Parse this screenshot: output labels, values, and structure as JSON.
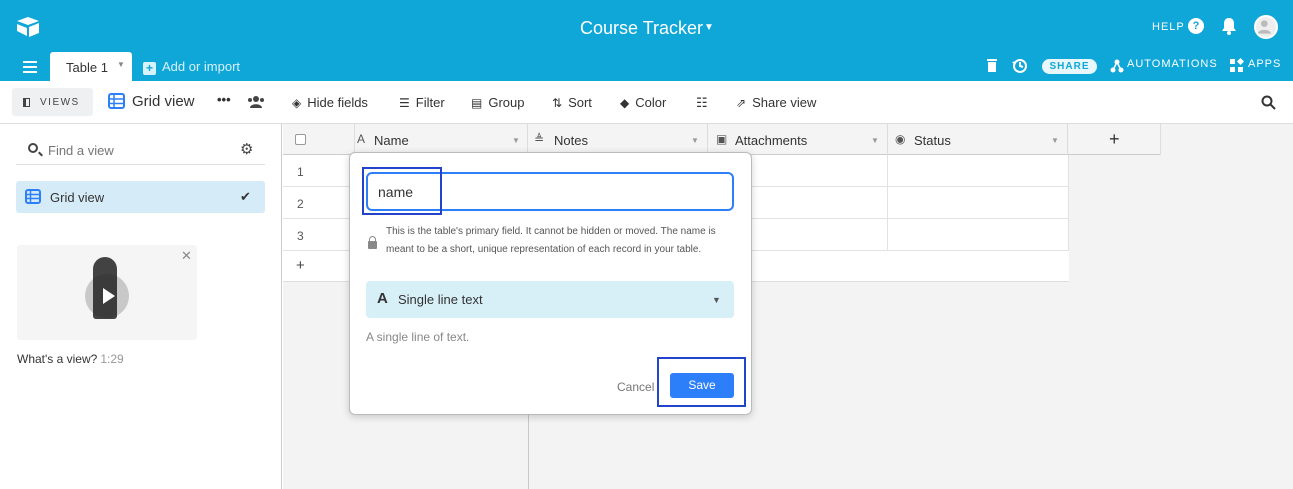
{
  "topbar": {
    "title": "Course Tracker",
    "help": "HELP",
    "help_icon": "?",
    "share": "SHARE",
    "automations": "AUTOMATIONS",
    "apps": "APPS",
    "table_tab": "Table 1",
    "add_or_import": "Add or import",
    "bg_color": "#0fa6d8"
  },
  "viewbar": {
    "views": "VIEWS",
    "view_name": "Grid view",
    "more": "•••",
    "hide_fields": "Hide fields",
    "filter": "Filter",
    "group": "Group",
    "sort": "Sort",
    "color": "Color",
    "share_view": "Share view"
  },
  "sidebar": {
    "find_placeholder": "Find a view",
    "grid_view": "Grid view",
    "check": "✔",
    "whats_view": "What's a view?",
    "duration": "1:29",
    "close": "✕"
  },
  "grid": {
    "columns": [
      {
        "name": "Name",
        "icon": "text-icon"
      },
      {
        "name": "Notes",
        "icon": "long-text-icon"
      },
      {
        "name": "Attachments",
        "icon": "attachment-icon"
      },
      {
        "name": "Status",
        "icon": "status-icon"
      }
    ],
    "add_column": "+",
    "rows": [
      "1",
      "2",
      "3"
    ],
    "add_row": "+"
  },
  "popup": {
    "field_name_value": "name",
    "description": "This is the table's primary field. It cannot be hidden or moved. The name is meant to be a short, unique representation of each record in your table.",
    "type_icon": "A",
    "type_label": "Single line text",
    "type_description": "A single line of text.",
    "cancel": "Cancel",
    "save": "Save"
  }
}
